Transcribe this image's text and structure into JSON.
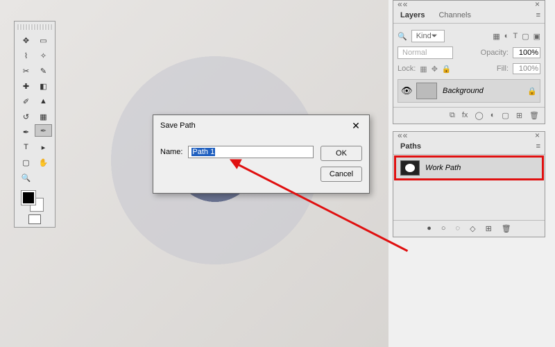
{
  "dialog": {
    "title": "Save Path",
    "name_label": "Name:",
    "name_value": "Path 1",
    "ok": "OK",
    "cancel": "Cancel"
  },
  "toolbox": {
    "tools": [
      [
        "move",
        "rect-marquee"
      ],
      [
        "lasso",
        "magic-wand"
      ],
      [
        "crop",
        "slice"
      ],
      [
        "eyedrop",
        "eraser"
      ],
      [
        "brush",
        "clone"
      ],
      [
        "history",
        "gradient"
      ],
      [
        "pen",
        "pen-free"
      ],
      [
        "type",
        "path-sel"
      ],
      [
        "shape",
        "hand"
      ],
      [
        "zoom",
        ""
      ]
    ]
  },
  "layers_panel": {
    "tab_layers": "Layers",
    "tab_channels": "Channels",
    "kind_label": "Kind",
    "blend_mode": "Normal",
    "opacity_label": "Opacity:",
    "opacity_value": "100%",
    "lock_label": "Lock:",
    "fill_label": "Fill:",
    "fill_value": "100%",
    "layer_name": "Background",
    "foot_icons": [
      "link",
      "fx",
      "mask",
      "adjust",
      "group",
      "new",
      "trash"
    ]
  },
  "paths_panel": {
    "tab": "Paths",
    "item": "Work Path",
    "foot_icons": [
      "fill",
      "stroke",
      "selection",
      "mask",
      "new",
      "trash"
    ]
  }
}
